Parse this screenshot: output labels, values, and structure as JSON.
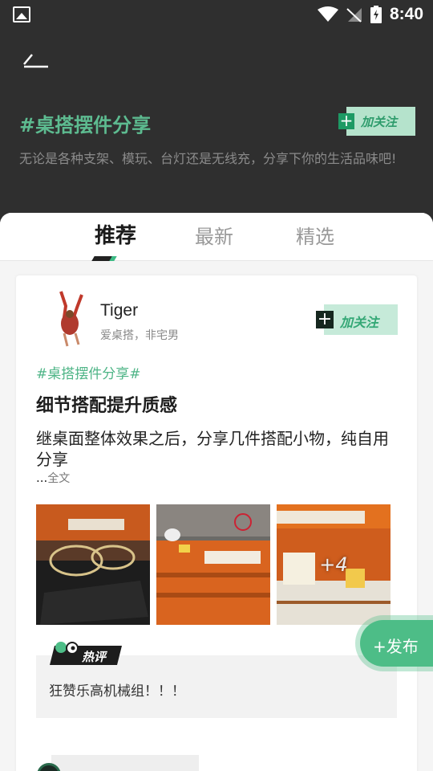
{
  "status_bar": {
    "time": "8:40"
  },
  "topic": {
    "title": "#桌搭摆件分享",
    "follow_label": "加关注",
    "description": "无论是各种支架、模玩、台灯还是无线充，分享下你的生活品味吧!"
  },
  "tabs": [
    {
      "label": "推荐",
      "active": true
    },
    {
      "label": "最新",
      "active": false
    },
    {
      "label": "精选",
      "active": false
    }
  ],
  "post": {
    "username": "Tiger",
    "user_signature": "爱桌搭，非宅男",
    "follow_label": "加关注",
    "tag": "#桌搭摆件分享#",
    "title": "细节搭配提升质感",
    "body": "继桌面整体效果之后，分享几件搭配小物，纯自用分享",
    "ellipsis": "...",
    "full_text_label": "全文",
    "more_images_label": "+4",
    "hot_badge_label": "热评",
    "hot_comment": "狂赞乐高机械组！！！"
  },
  "publish_button": {
    "label": "+发布"
  },
  "colors": {
    "accent": "#4dbd87",
    "dark_bg": "#2f2f2f"
  }
}
